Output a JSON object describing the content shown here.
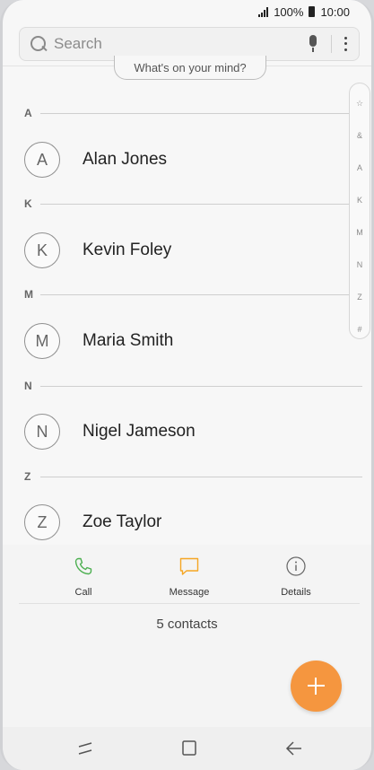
{
  "status_bar": {
    "battery": "100%",
    "time": "10:00"
  },
  "search": {
    "placeholder": "Search"
  },
  "profile_prompt": "What's on your mind?",
  "sections": [
    {
      "letter": "A",
      "contacts": [
        {
          "initial": "A",
          "name": "Alan Jones"
        }
      ]
    },
    {
      "letter": "K",
      "contacts": [
        {
          "initial": "K",
          "name": "Kevin Foley"
        }
      ]
    },
    {
      "letter": "M",
      "contacts": [
        {
          "initial": "M",
          "name": "Maria Smith"
        }
      ]
    },
    {
      "letter": "N",
      "contacts": [
        {
          "initial": "N",
          "name": "Nigel Jameson"
        }
      ]
    },
    {
      "letter": "Z",
      "contacts": [
        {
          "initial": "Z",
          "name": "Zoe Taylor"
        }
      ]
    }
  ],
  "index_bar": [
    "☆",
    "&",
    "A",
    "K",
    "M",
    "N",
    "Z",
    "#"
  ],
  "actions": {
    "call": "Call",
    "message": "Message",
    "details": "Details"
  },
  "contact_count": "5 contacts",
  "colors": {
    "accent": "#f5963f",
    "call_icon": "#4caf50",
    "message_icon": "#f5a623"
  },
  "icons": {
    "search": "search-icon",
    "mic": "mic-icon",
    "more": "more-options-icon",
    "call": "phone-icon",
    "message": "message-icon",
    "details": "info-icon",
    "fab": "add-icon",
    "recents": "recents-icon",
    "home": "home-icon",
    "back": "back-icon"
  }
}
